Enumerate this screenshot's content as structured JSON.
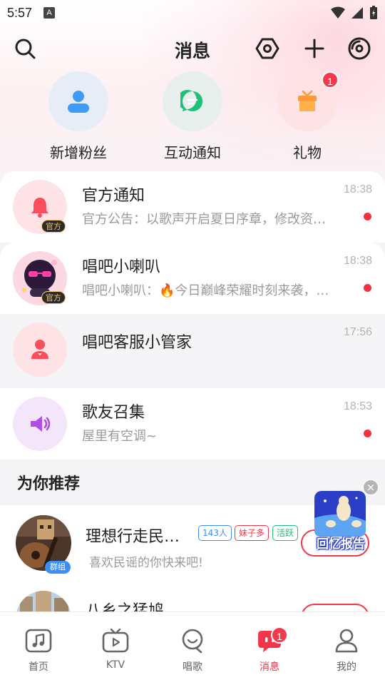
{
  "status_bar": {
    "time": "5:57",
    "notif_icon_letter": "A"
  },
  "header": {
    "title": "消息",
    "icons": [
      "search-icon",
      "hexagon-settings-icon",
      "plus-icon",
      "disc-icon"
    ]
  },
  "quick_actions": [
    {
      "label": "新增粉丝",
      "icon": "person-icon",
      "color": "#3f9cf6",
      "bg": "#e7edf7"
    },
    {
      "label": "互动通知",
      "icon": "chat-bubble-icon",
      "color": "#1ec07a",
      "bg": "#e7efed"
    },
    {
      "label": "礼物",
      "icon": "gift-icon",
      "color": "#ff9a3c",
      "bg": "#fde6e2",
      "badge": "1"
    }
  ],
  "messages": [
    {
      "name": "官方通知",
      "preview": "官方公告：以歌声开启夏日序章，修改资料赢取夏日限定好礼",
      "time": "18:38",
      "unread": true,
      "tag": "官方"
    },
    {
      "name": "唱吧小喇叭",
      "preview": "唱吧小喇叭：🔥今日巅峰荣耀时刻来袭，快来围观",
      "time": "18:38",
      "unread": true,
      "tag": "官方"
    },
    {
      "name": "唱吧客服小管家",
      "preview": "",
      "time": "17:56",
      "unread": false
    },
    {
      "name": "歌友召集",
      "preview": "屋里有空调~",
      "time": "18:53",
      "unread": true
    }
  ],
  "recommend": {
    "title": "为你推荐",
    "items": [
      {
        "name": "理想行走民…",
        "desc": "喜欢民谣的你快来吧!",
        "badge": "群组",
        "chips": [
          {
            "text": "143人",
            "color": "#3a8ff6"
          },
          {
            "text": "妹子多",
            "color": "#f2364a"
          },
          {
            "text": "活跃",
            "color": "#1ec07a"
          }
        ]
      },
      {
        "name": "八乡之猛鸠"
      }
    ]
  },
  "promo": {
    "text": "回忆报告",
    "close": "×"
  },
  "tabbar": [
    {
      "label": "首页",
      "icon": "music-note-icon"
    },
    {
      "label": "KTV",
      "icon": "tv-play-icon"
    },
    {
      "label": "唱歌",
      "icon": "microphone-icon"
    },
    {
      "label": "消息",
      "icon": "message-icon",
      "active": true,
      "badge": "1"
    },
    {
      "label": "我的",
      "icon": "profile-icon"
    }
  ]
}
